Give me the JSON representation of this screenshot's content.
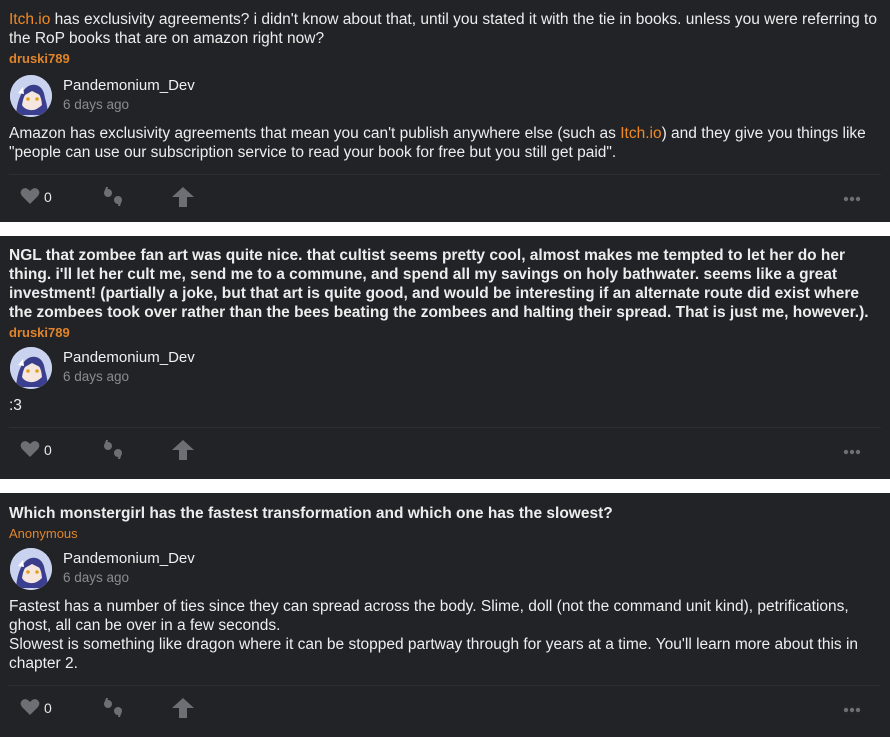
{
  "posts": [
    {
      "question_link": "Itch.io",
      "question_rest": " has exclusivity agreements? i didn't know about that, until you stated it with the tie in books. unless you were referring to the RoP books that are on amazon right now?",
      "asker": "druski789",
      "author": "Pandemonium_Dev",
      "time": "6 days ago",
      "answer_pre": "Amazon has exclusivity agreements that mean you can't publish anywhere else (such as ",
      "answer_link": "Itch.io",
      "answer_post": ") and they give you things like \"people can use our subscription service to read your book for free but you still get paid\".",
      "likes": "0"
    },
    {
      "question": "NGL that zombee fan art was quite nice. that cultist seems pretty cool, almost makes me tempted to let her do her thing. i'll let her cult me, send me to a commune, and spend all my savings on holy bathwater. seems like a great investment! (partially a joke, but that art is quite good, and would be interesting if an alternate route did exist where the zombees took over rather than the bees beating the zombees and halting their spread. That is just me, however.).",
      "asker": "druski789",
      "author": "Pandemonium_Dev",
      "time": "6 days ago",
      "answer": ":3",
      "likes": "0"
    },
    {
      "question": "Which monstergirl has the fastest transformation and which one has the slowest?",
      "asker": "Anonymous",
      "author": "Pandemonium_Dev",
      "time": "6 days ago",
      "answer_line1": "Fastest has a number of ties since they can spread across the body. Slime, doll (not the command unit kind), petrifications, ghost, all can be over in a few seconds.",
      "answer_line2": "Slowest is something like dragon where it can be stopped partway through for years at a time. You'll learn more about this in chapter 2.",
      "likes": "0"
    }
  ],
  "colors": {
    "card_bg": "#222327",
    "page_gap": "#ffffff",
    "accent_orange": "#f08a24",
    "muted_text": "#8b8c91",
    "icon_gray": "#6e6f74"
  },
  "icons": [
    "heart-icon",
    "quote-icon",
    "share-arrow-icon",
    "more-dots-icon",
    "avatar"
  ]
}
